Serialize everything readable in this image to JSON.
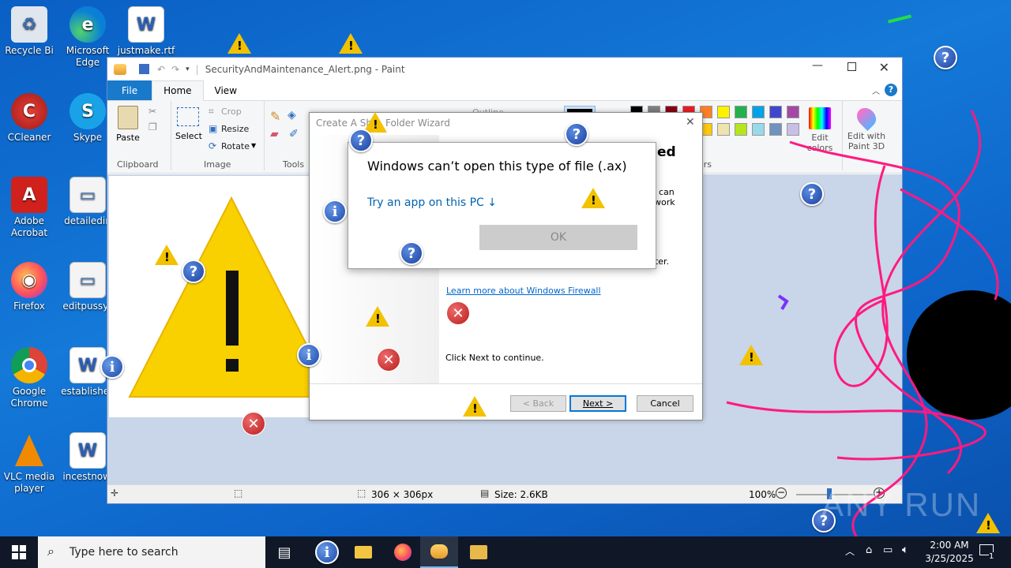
{
  "desktop": {
    "icons": [
      {
        "label": "Recycle Bin",
        "display": "Recycle Bi"
      },
      {
        "label": "Microsoft Edge",
        "line1": "Microsoft",
        "line2": "Edge"
      },
      {
        "label": "justmake.rtf"
      },
      {
        "label": "CCleaner"
      },
      {
        "label": "Skype"
      },
      {
        "label": "Adobe Acrobat",
        "line1": "Adobe",
        "line2": "Acrobat"
      },
      {
        "label": "detailedin"
      },
      {
        "label": "Firefox"
      },
      {
        "label": "editpussy.j"
      },
      {
        "label": "Google Chrome",
        "line1": "Google",
        "line2": "Chrome"
      },
      {
        "label": "establishec"
      },
      {
        "label": "VLC media player",
        "line1": "VLC media",
        "line2": "player"
      },
      {
        "label": "incestnow."
      }
    ]
  },
  "paint": {
    "title": "SecurityAndMaintenance_Alert.png - Paint",
    "tabs": {
      "file": "File",
      "home": "Home",
      "view": "View"
    },
    "ribbon": {
      "paste": "Paste",
      "clipboard": "Clipboard",
      "select": "Select",
      "crop": "Crop",
      "resize": "Resize",
      "rotate": "Rotate",
      "image": "Image",
      "tools": "Tools",
      "outline": "Outline",
      "edit_colors_1": "Edit",
      "edit_colors_2": "colors",
      "edit_paint3d_1": "Edit with",
      "edit_paint3d_2": "Paint 3D",
      "colors_group": "Colors"
    },
    "palette": [
      "#000000",
      "#7f7f7f",
      "#880015",
      "#ed1c24",
      "#ff7f27",
      "#fff200",
      "#22b14c",
      "#00a2e8",
      "#3f48cc",
      "#a349a4",
      "#ffffff",
      "#c3c3c3",
      "#b97a57",
      "#ffaec9",
      "#ffc90e",
      "#efe4b0",
      "#b5e61d",
      "#99d9ea",
      "#7092be",
      "#c8bfe7"
    ],
    "status": {
      "dimensions": "306 × 306px",
      "size": "Size: 2.6KB",
      "zoom": "100%"
    }
  },
  "wizard": {
    "title": "Create A Shared Folder Wizard",
    "title_visible": "Create A Sh",
    "title_visible_2": "Folder Wizard",
    "heading_fragment": "ed",
    "text_can": "can",
    "text_work": "work",
    "text_uter": "uter.",
    "firewall_link": "Learn more about Windows Firewall",
    "continue_text": "Click Next to continue.",
    "buttons": {
      "back": "< Back",
      "next": "Next >",
      "cancel": "Cancel"
    }
  },
  "dialog": {
    "heading": "Windows can’t open this type of file (.ax)",
    "try_app": "Try an app on this PC ↓",
    "ok": "OK"
  },
  "taskbar": {
    "search_placeholder": "Type here to search",
    "time": "2:00 AM",
    "date": "3/25/2025",
    "notification_count": "1"
  },
  "watermark": "ANY RUN",
  "colors": {
    "desktop_blue": "#1479d8",
    "paint_accent": "#1979ca",
    "warning_yellow": "#f9d000",
    "scribble_pink": "#ff1a80",
    "link_blue": "#0066cc"
  }
}
